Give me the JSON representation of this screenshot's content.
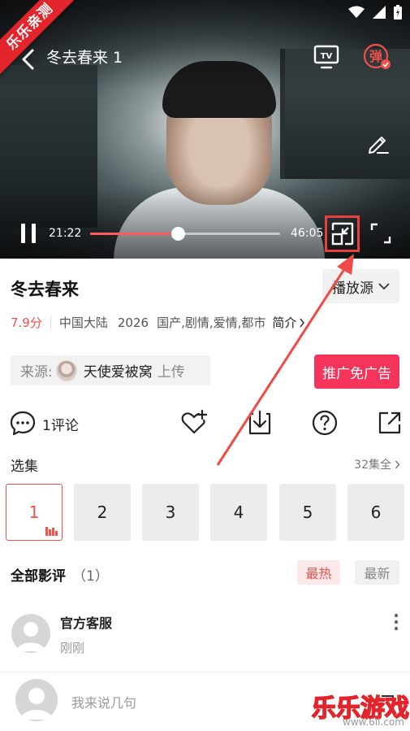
{
  "watermark_corner": "乐乐亲测",
  "player": {
    "title": "冬去春来 1",
    "current_time": "21:22",
    "duration": "46:05",
    "progress": 0.46,
    "danmu_label": "弹",
    "tv_label": "TV"
  },
  "show": {
    "title": "冬去春来",
    "source_dropdown": "播放源",
    "rating": "7.9分",
    "region": "中国大陆",
    "year": "2026",
    "genres": "国产,剧情,爱情,都市",
    "intro_label": "简介"
  },
  "uploader": {
    "label": "来源:",
    "name": "天使爱被窝",
    "action": "上传"
  },
  "promo_button": "推广免广告",
  "actions": {
    "comment_count": "1评论"
  },
  "episodes": {
    "title": "选集",
    "total": "32集全",
    "items": [
      "1",
      "2",
      "3",
      "4",
      "5",
      "6"
    ]
  },
  "reviews": {
    "title": "全部影评",
    "count": "（1）",
    "sort_hot": "最热",
    "sort_new": "最新",
    "items": [
      {
        "user": "官方客服",
        "time": "刚刚"
      }
    ]
  },
  "comment_input": {
    "placeholder": "我来说几句"
  },
  "watermark": {
    "text": "乐乐游戏",
    "url": "www.6ll.com"
  },
  "colors": {
    "accent": "#f0524a",
    "promo": "#f4345a",
    "ribbon": "#e3242b"
  }
}
